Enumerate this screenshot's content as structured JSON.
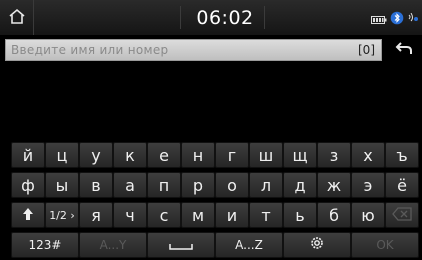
{
  "status_bar": {
    "time": "06:02",
    "icons": [
      "home-icon",
      "battery-icon",
      "bluetooth-icon",
      "signal-icon"
    ]
  },
  "input": {
    "placeholder": "Введите имя или номер",
    "count": "[0]",
    "back_icon": "back-arrow-icon"
  },
  "keyboard": {
    "row1": [
      "й",
      "ц",
      "у",
      "к",
      "е",
      "н",
      "г",
      "ш",
      "щ",
      "з",
      "х",
      "ъ"
    ],
    "row2": [
      "ф",
      "ы",
      "в",
      "а",
      "п",
      "р",
      "о",
      "л",
      "д",
      "ж",
      "э",
      "ё"
    ],
    "row3": {
      "shift_icon": "shift-arrow-icon",
      "page_label": "1/2 ›",
      "letters": [
        "я",
        "ч",
        "с",
        "м",
        "и",
        "т",
        "ь",
        "б",
        "ю"
      ],
      "backspace_icon": "backspace-icon"
    },
    "row4": {
      "numbers_label": "123#",
      "lang_latin_label": "A...Y",
      "space_icon": "space-bar-icon",
      "lang_az_label": "A...Z",
      "settings_icon": "gear-icon",
      "ok_label": "OK"
    }
  }
}
